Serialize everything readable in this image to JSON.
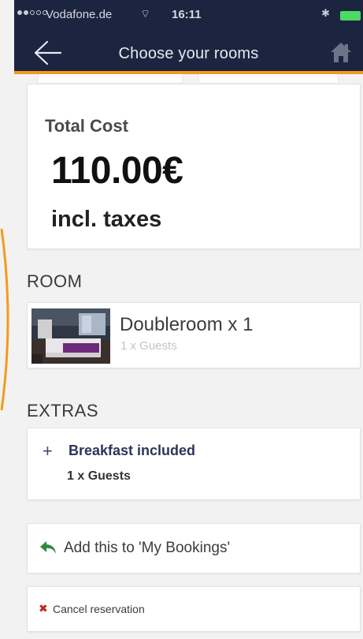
{
  "status_bar": {
    "carrier": "Vodafone.de",
    "time": "16:11",
    "wifi_icon": "wifi-icon",
    "bluetooth_icon": "bluetooth-icon",
    "battery_icon": "battery-icon",
    "battery_color": "#4cd964"
  },
  "header": {
    "title": "Choose your rooms",
    "back_icon": "back-arrow-icon",
    "home_icon": "home-icon",
    "background_color": "#1c2540",
    "accent_color": "#f39a1e"
  },
  "cost": {
    "label": "Total Cost",
    "amount": "110.00€",
    "taxes_note": "incl. taxes"
  },
  "room": {
    "heading": "ROOM",
    "name": "Doubleroom x 1",
    "guests": "1 x Guests",
    "thumbnail_icon": "hotel-room-photo"
  },
  "extras": {
    "heading": "EXTRAS",
    "items": [
      {
        "icon": "plus-icon",
        "name": "Breakfast included",
        "guests": "1 x Guests"
      }
    ]
  },
  "actions": {
    "add_booking_label": "Add this to 'My Bookings'",
    "add_booking_icon": "reply-arrow-icon",
    "add_booking_icon_color": "#2e8b3a",
    "cancel_label": "Cancel reservation",
    "cancel_icon": "close-icon",
    "cancel_icon_color": "#c0251b"
  }
}
